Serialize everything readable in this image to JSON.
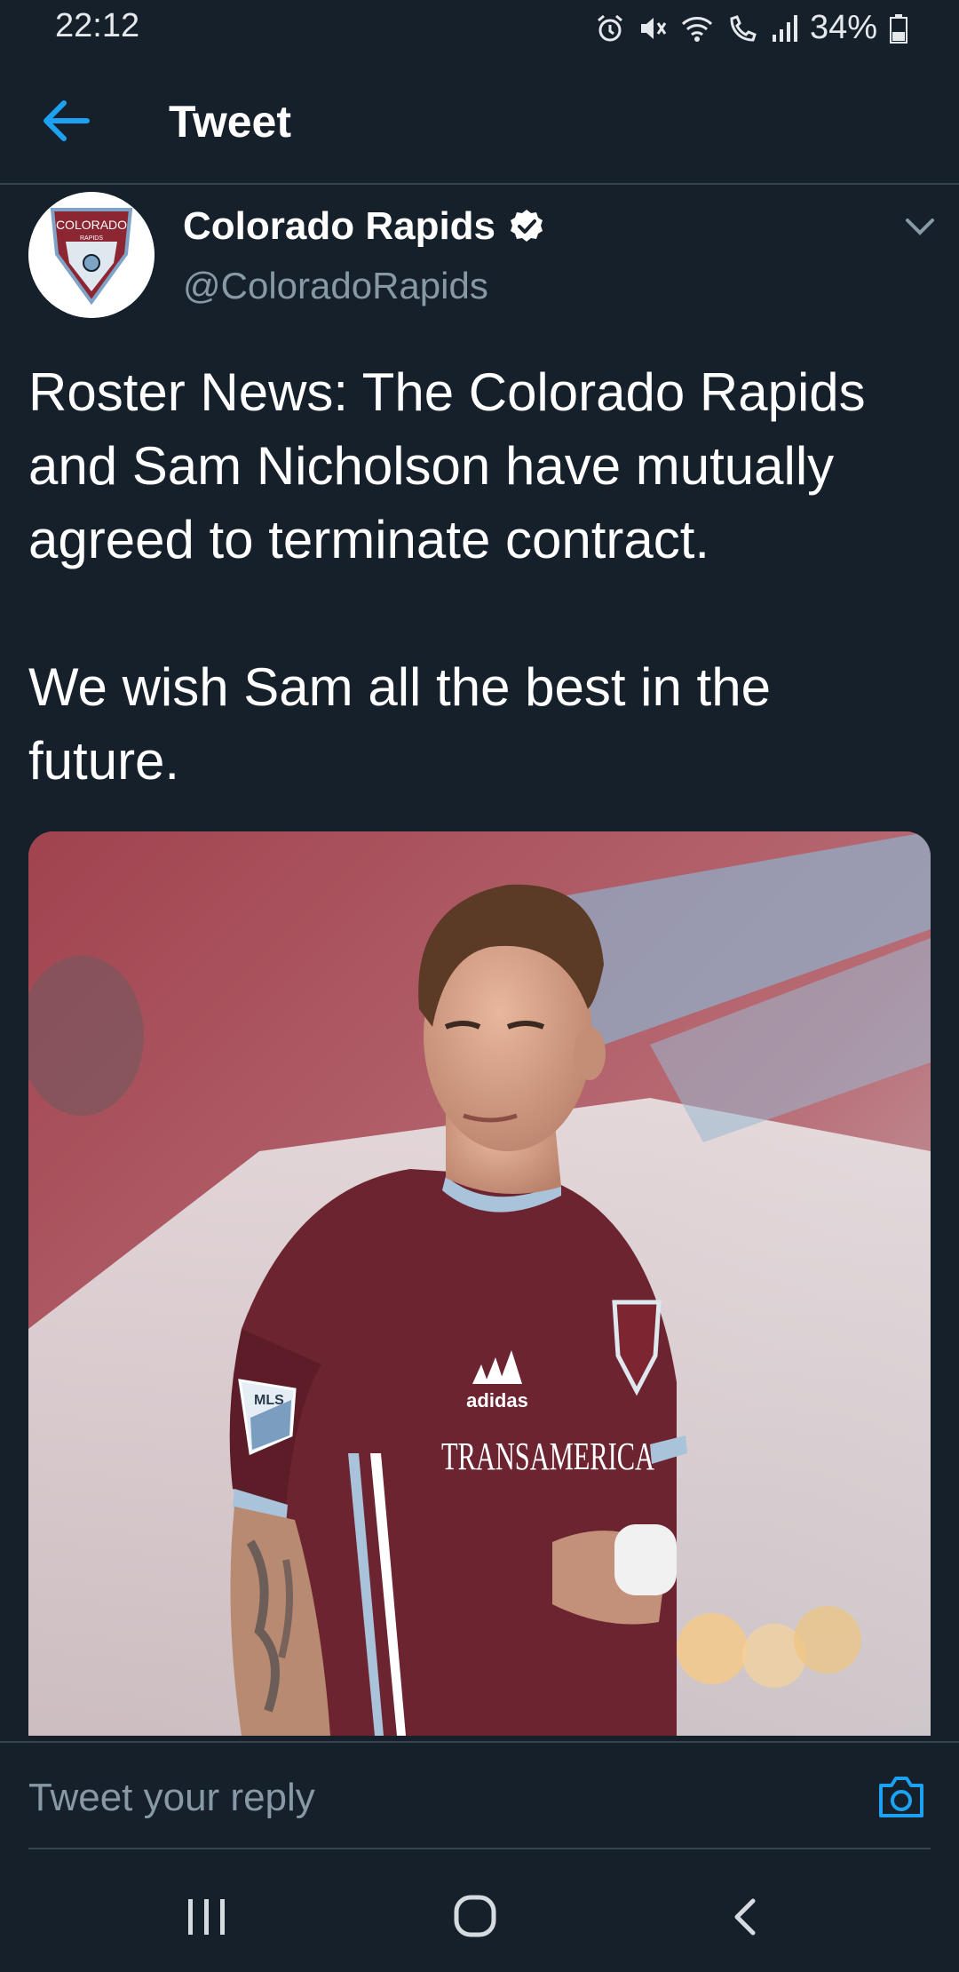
{
  "status_bar": {
    "time": "22:12",
    "battery": "34%",
    "icons": [
      "alarm-icon",
      "mute-icon",
      "wifi-icon",
      "wifi-call-icon",
      "signal-icon",
      "battery-icon"
    ]
  },
  "header": {
    "title": "Tweet",
    "back_icon": "back-arrow-icon"
  },
  "tweet": {
    "author_name": "Colorado Rapids",
    "author_handle": "@ColoradoRapids",
    "verified": true,
    "text": "Roster News: The Colorado Rapids and Sam Nicholson have mutually agreed to terminate contract.\n\nWe wish Sam all the best in the future.",
    "avatar_text": "COLORADO",
    "avatar_subtext": "RAPIDS",
    "media": {
      "jersey_brand": "adidas",
      "jersey_sponsor": "TRANSAMERICA",
      "sleeve_badge": "MLS"
    }
  },
  "reply": {
    "placeholder": "Tweet your reply",
    "camera_icon": "camera-icon"
  },
  "colors": {
    "background": "#15202b",
    "accent": "#1da1f2",
    "secondary_text": "#8899a6",
    "divider": "#38444d"
  }
}
